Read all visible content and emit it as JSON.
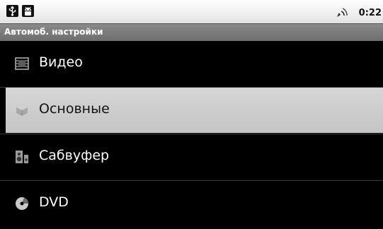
{
  "status_bar": {
    "left_icons": [
      "usb-icon",
      "android-debug-icon"
    ],
    "signal_icon": "signal-icon",
    "time": "0:22"
  },
  "title_bar": {
    "title": "Автомоб. настройки"
  },
  "menu": {
    "items": [
      {
        "label": "Видео",
        "icon": "film-icon",
        "selected": false
      },
      {
        "label": "Основные",
        "icon": "cube-icon",
        "selected": true
      },
      {
        "label": "Сабвуфер",
        "icon": "speaker-icon",
        "selected": false
      },
      {
        "label": "DVD",
        "icon": "disc-icon",
        "selected": false
      }
    ]
  },
  "colors": {
    "list_background": "#000000",
    "selected_background": "#cfcfcf",
    "title_bar": "#7a7a7a",
    "status_bar": "#f0f0f0"
  }
}
